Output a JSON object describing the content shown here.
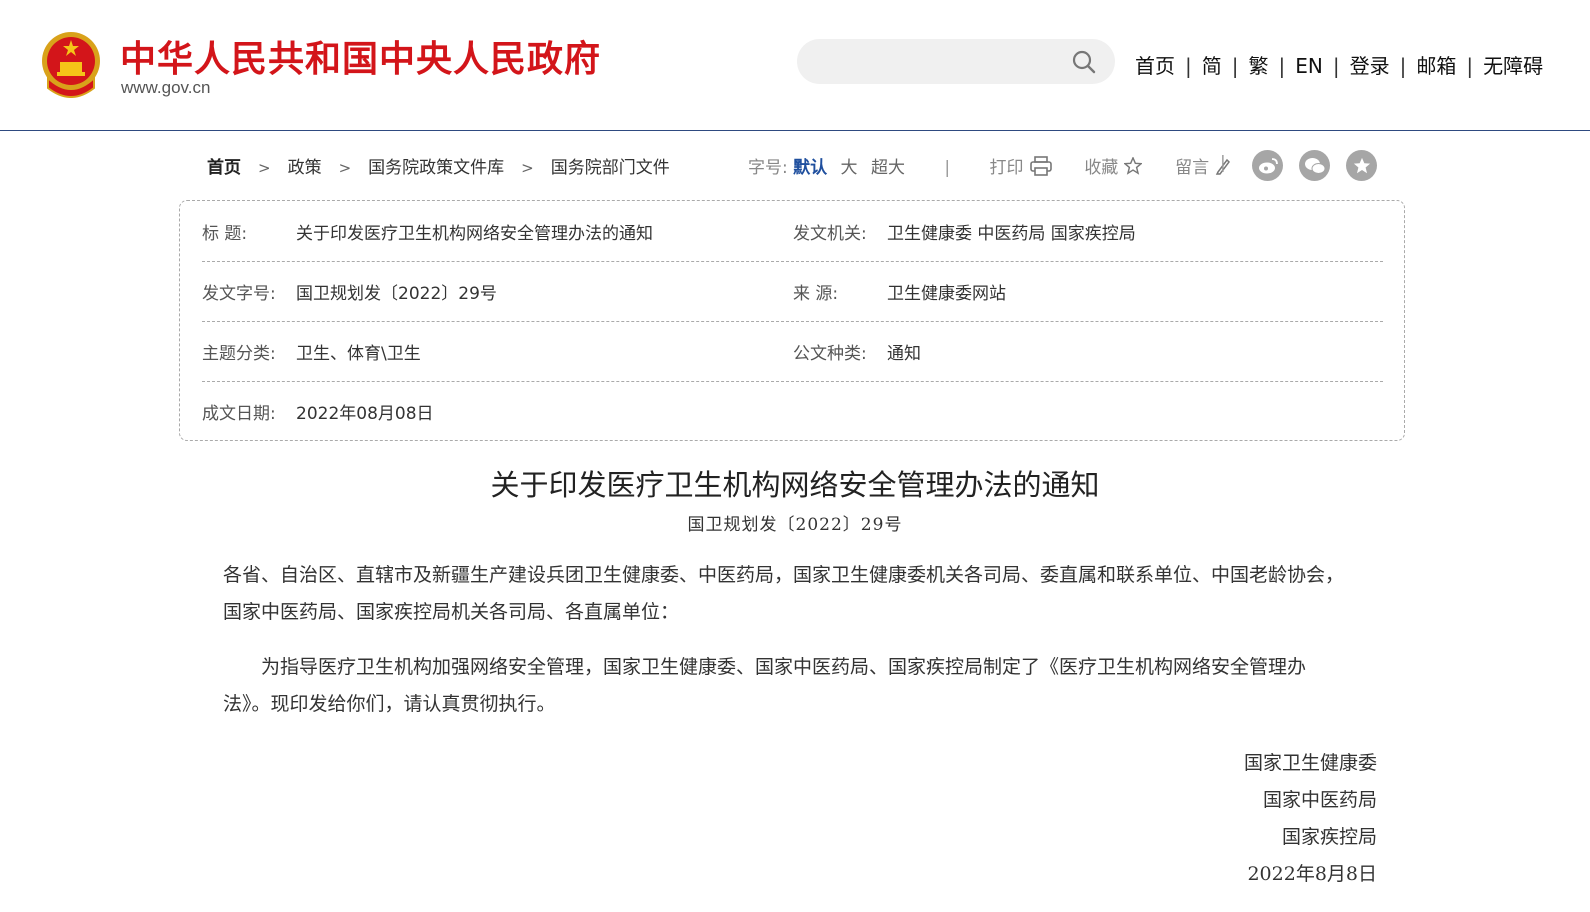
{
  "header": {
    "site_title": "中华人民共和国中央人民政府",
    "site_url": "www.gov.cn",
    "search_placeholder": "",
    "links": [
      "首页",
      "简",
      "繁",
      "EN",
      "登录",
      "邮箱",
      "无障碍"
    ],
    "brand_color": "#d3151a"
  },
  "breadcrumb": [
    "首页",
    "政策",
    "国务院政策文件库",
    "国务院部门文件"
  ],
  "tools": {
    "font_label": "字号:",
    "font_default": "默认",
    "font_large": "大",
    "font_xlarge": "超大",
    "print": "打印",
    "favorite": "收藏",
    "comment": "留言",
    "share_icons": [
      "weibo-icon",
      "wechat-icon",
      "star-icon"
    ]
  },
  "info": {
    "title_label": "标 题:",
    "title_value": "关于印发医疗卫生机构网络安全管理办法的通知",
    "issuer_label": "发文机关:",
    "issuer_value": "卫生健康委 中医药局 国家疾控局",
    "docno_label": "发文字号:",
    "docno_value": "国卫规划发〔2022〕29号",
    "source_label": "来 源:",
    "source_value": "卫生健康委网站",
    "topic_label": "主题分类:",
    "topic_value": "卫生、体育\\卫生",
    "type_label": "公文种类:",
    "type_value": "通知",
    "date_label": "成文日期:",
    "date_value": "2022年08月08日"
  },
  "article": {
    "title": "关于印发医疗卫生机构网络安全管理办法的通知",
    "doc_no": "国卫规划发〔2022〕29号",
    "para1": "各省、自治区、直辖市及新疆生产建设兵团卫生健康委、中医药局，国家卫生健康委机关各司局、委直属和联系单位、中国老龄协会，国家中医药局、国家疾控局机关各司局、各直属单位：",
    "para2": "为指导医疗卫生机构加强网络安全管理，国家卫生健康委、国家中医药局、国家疾控局制定了《医疗卫生机构网络安全管理办法》。现印发给你们，请认真贯彻执行。",
    "sign1": "国家卫生健康委",
    "sign2": "国家中医药局",
    "sign3": "国家疾控局",
    "sign_date": "2022年8月8日"
  }
}
